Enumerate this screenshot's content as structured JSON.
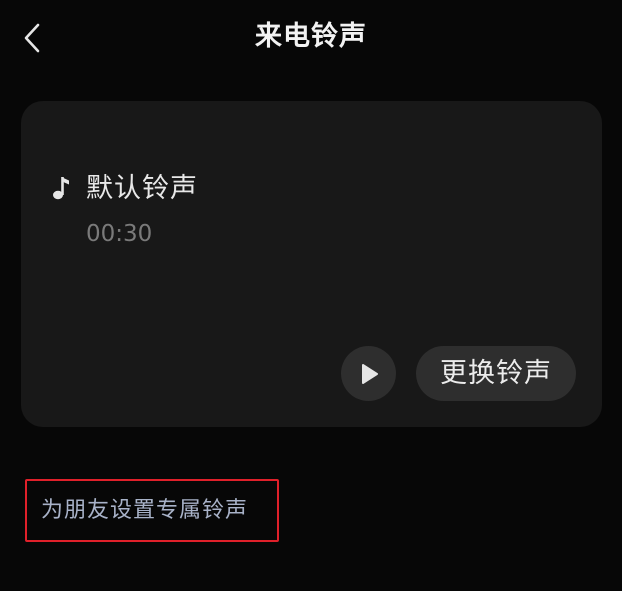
{
  "header": {
    "back_icon": "chevron-left-icon",
    "title": "来电铃声"
  },
  "ringtone_card": {
    "note_icon": "music-note-icon",
    "name": "默认铃声",
    "duration": "00:30",
    "play_icon": "play-icon",
    "change_label": "更换铃声"
  },
  "friend_ringtone": {
    "label": "为朋友设置专属铃声"
  },
  "colors": {
    "background": "#070707",
    "card": "#181818",
    "button": "#2e2e2e",
    "link": "#a8b2c8",
    "highlight_border": "#e0202a"
  }
}
